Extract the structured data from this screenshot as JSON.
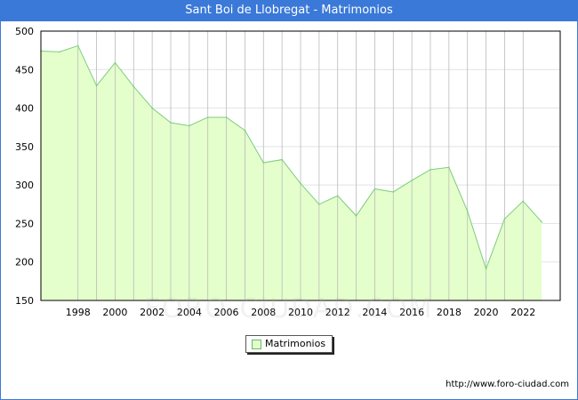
{
  "header": {
    "title": "Sant Boi de Llobregat - Matrimonios"
  },
  "legend": {
    "label": "Matrimonios"
  },
  "footer": {
    "source_url": "http://www.foro-ciudad.com"
  },
  "watermark": {
    "text": "FORO-CIUDAD.COM"
  },
  "colors": {
    "title_bar": "#3a79d8",
    "area_fill": "#e4ffcc",
    "line": "#7ccc7c",
    "grid": "#bbbbbb"
  },
  "chart_data": {
    "type": "area",
    "x": [
      1996,
      1997,
      1998,
      1999,
      2000,
      2001,
      2002,
      2003,
      2004,
      2005,
      2006,
      2007,
      2008,
      2009,
      2010,
      2011,
      2012,
      2013,
      2014,
      2015,
      2016,
      2017,
      2018,
      2019,
      2020,
      2021,
      2022,
      2023
    ],
    "series": [
      {
        "name": "Matrimonios",
        "values": [
          474,
          473,
          481,
          429,
          459,
          428,
          400,
          381,
          377,
          388,
          388,
          371,
          329,
          333,
          302,
          275,
          286,
          260,
          295,
          291,
          306,
          320,
          323,
          266,
          191,
          256,
          279,
          252
        ]
      }
    ],
    "xticks": [
      "1998",
      "2000",
      "2002",
      "2004",
      "2006",
      "2008",
      "2010",
      "2012",
      "2014",
      "2016",
      "2018",
      "2020",
      "2022"
    ],
    "yticks": [
      "150",
      "200",
      "250",
      "300",
      "350",
      "400",
      "450",
      "500"
    ],
    "xlim": [
      1996,
      2024
    ],
    "ylim": [
      150,
      500
    ],
    "grid": true,
    "legend_position": "bottom-center"
  }
}
